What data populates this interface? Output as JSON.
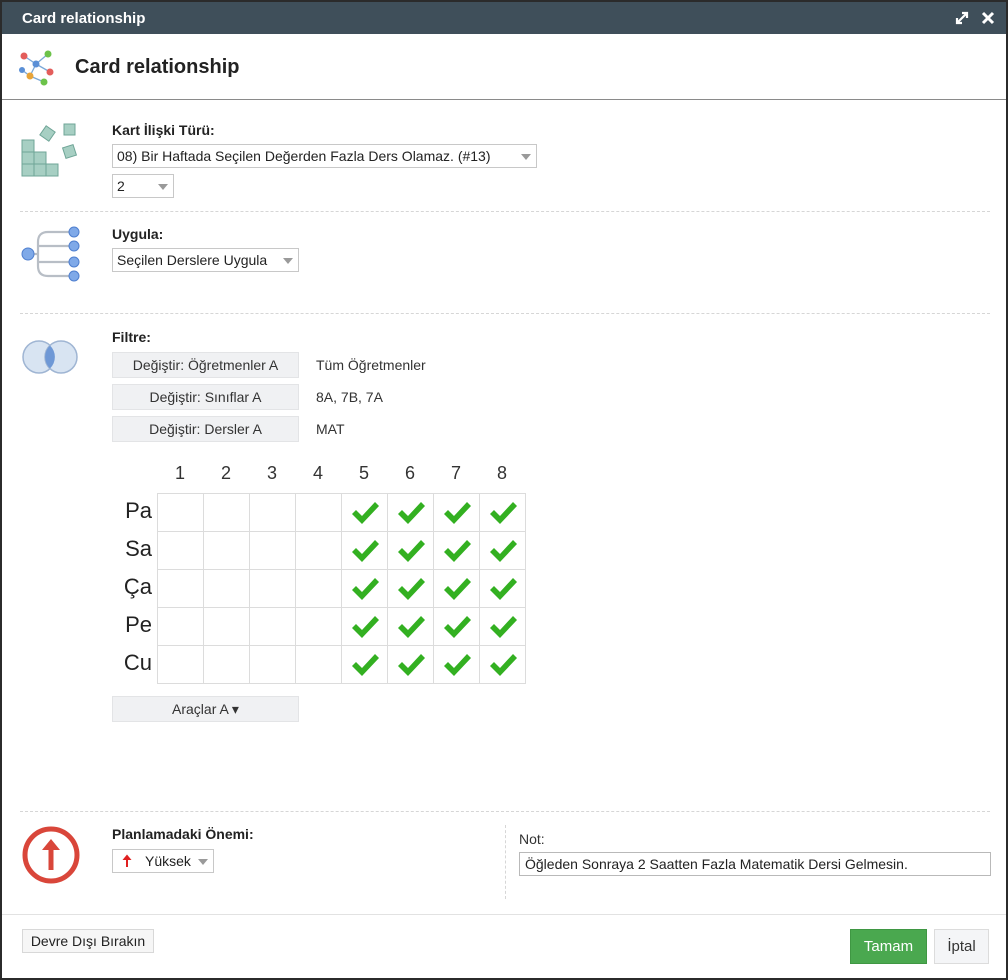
{
  "window": {
    "title": "Card relationship",
    "maximize_icon": "expand-arrows-icon",
    "close_icon": "close-x-icon"
  },
  "header": {
    "title": "Card relationship",
    "icon": "network-graph-icon"
  },
  "relation_type": {
    "label": "Kart İlişki Türü:",
    "selected": "08) Bir Haftada Seçilen Değerden Fazla Ders Olamaz. (#13)",
    "value_selected": "2",
    "icon": "blocks-icon"
  },
  "apply": {
    "label": "Uygula:",
    "selected": "Seçilen Derslere Uygula",
    "icon": "branch-tree-icon"
  },
  "filter": {
    "label": "Filtre:",
    "icon": "venn-circles-icon",
    "rows": [
      {
        "button": "Değiştir: Öğretmenler A",
        "value": "Tüm Öğretmenler"
      },
      {
        "button": "Değiştir: Sınıflar A",
        "value": "8A, 7B, 7A"
      },
      {
        "button": "Değiştir: Dersler A",
        "value": "MAT"
      }
    ]
  },
  "grid": {
    "columns": [
      "1",
      "2",
      "3",
      "4",
      "5",
      "6",
      "7",
      "8"
    ],
    "rows": [
      "Pa",
      "Sa",
      "Ça",
      "Pe",
      "Cu"
    ],
    "checked": [
      [
        false,
        false,
        false,
        false,
        true,
        true,
        true,
        true
      ],
      [
        false,
        false,
        false,
        false,
        true,
        true,
        true,
        true
      ],
      [
        false,
        false,
        false,
        false,
        true,
        true,
        true,
        true
      ],
      [
        false,
        false,
        false,
        false,
        true,
        true,
        true,
        true
      ],
      [
        false,
        false,
        false,
        false,
        true,
        true,
        true,
        true
      ]
    ],
    "check_color": "#33b021",
    "tools_button": "Araçlar A ▾"
  },
  "importance": {
    "label": "Planlamadaki Önemi:",
    "selected": "Yüksek",
    "icon": "up-arrow-circle-icon",
    "icon_color": "#d9463a"
  },
  "note": {
    "label": "Not:",
    "value": "Öğleden Sonraya 2 Saatten Fazla Matematik Dersi Gelmesin."
  },
  "footer": {
    "disable_button": "Devre Dışı Bırakın",
    "ok_button": "Tamam",
    "cancel_button": "İptal",
    "ok_color": "#4aa84f"
  }
}
